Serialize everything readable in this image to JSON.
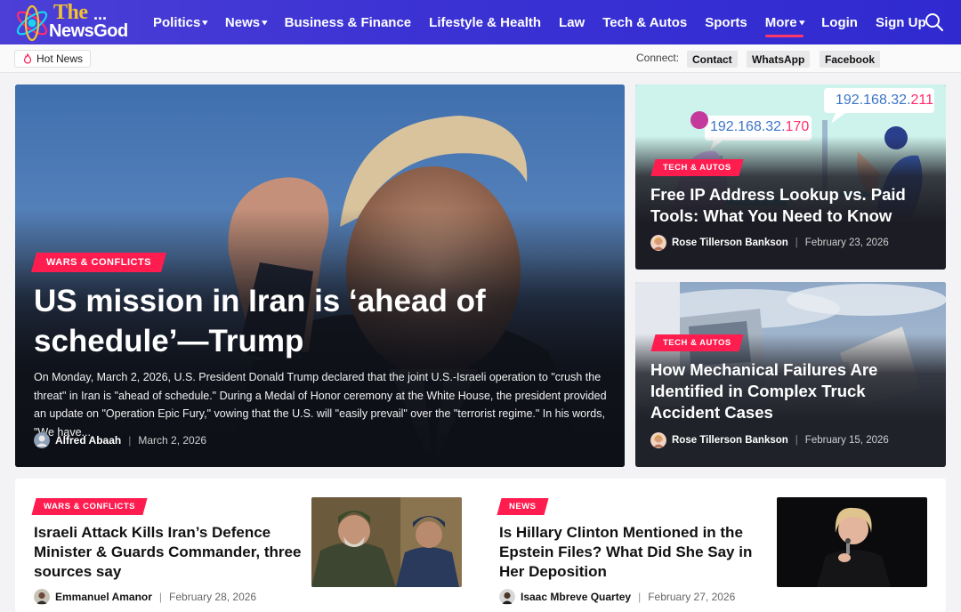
{
  "brand": {
    "logo_top": "The",
    "logo_dots": "...",
    "logo_bottom": "NewsGod"
  },
  "nav": {
    "items": [
      {
        "label": "Politics",
        "dropdown": true
      },
      {
        "label": "News",
        "dropdown": true
      },
      {
        "label": "Business & Finance",
        "dropdown": false
      },
      {
        "label": "Lifestyle & Health",
        "dropdown": false
      },
      {
        "label": "Law",
        "dropdown": false
      },
      {
        "label": "Tech & Autos",
        "dropdown": false
      },
      {
        "label": "Sports",
        "dropdown": false
      },
      {
        "label": "More",
        "dropdown": true,
        "active": true
      },
      {
        "label": "Login",
        "dropdown": false
      },
      {
        "label": "Sign Up",
        "dropdown": false
      }
    ],
    "search_icon": "search-icon"
  },
  "subbar": {
    "hot_news": "Hot News",
    "connect_label": "Connect:",
    "links": [
      "Contact",
      "WhatsApp",
      "Facebook"
    ]
  },
  "hero": {
    "category": "WARS & CONFLICTS",
    "title": "US mission in Iran is ‘ahead of schedule’—Trump",
    "excerpt": "On Monday, March 2, 2026, U.S. President Donald Trump declared that the joint U.S.-Israeli operation to \"crush the threat\" in Iran is \"ahead of schedule.\" During a Medal of Honor ceremony at the White House, the president provided an update on \"Operation Epic Fury,\" vowing that the U.S. will \"easily prevail\" over the \"terrorist regime.\" In his words, \"We have...",
    "author": "Alfred Abaah",
    "date": "March 2, 2026"
  },
  "side_cards": [
    {
      "category": "TECH & AUTOS",
      "title": "Free IP Address Lookup vs. Paid Tools: What You Need to Know",
      "author": "Rose Tillerson Bankson",
      "date": "February 23, 2026",
      "image_text": {
        "ip_left_main": "192.168.32.",
        "ip_left_tail": "170",
        "ip_right_main": "192.168.32.",
        "ip_right_tail": "211"
      }
    },
    {
      "category": "TECH & AUTOS",
      "title": "How Mechanical Failures Are Identified in Complex Truck Accident Cases",
      "author": "Rose Tillerson Bankson",
      "date": "February 15, 2026"
    }
  ],
  "bottom_cards": [
    {
      "category": "WARS & CONFLICTS",
      "title": "Israeli Attack Kills Iran’s Defence Minister & Guards Commander, three sources say",
      "author": "Emmanuel Amanor",
      "date": "February 28, 2026"
    },
    {
      "category": "NEWS",
      "title": "Is Hillary Clinton Mentioned in the Epstein Files? What Did She Say in Her Deposition",
      "author": "Isaac Mbreve Quartey",
      "date": "February 27, 2026"
    }
  ],
  "colors": {
    "header": "#3d33d4",
    "accent": "#ff1d4f",
    "logo_yellow": "#f2c230"
  }
}
